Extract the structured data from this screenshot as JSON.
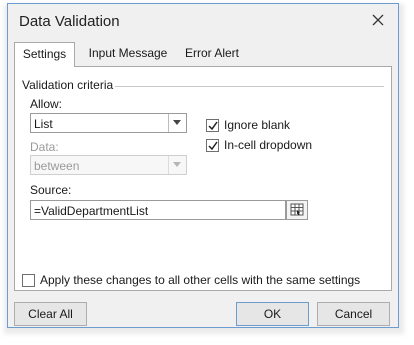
{
  "dialog": {
    "title": "Data Validation"
  },
  "tabs": [
    {
      "label": "Settings"
    },
    {
      "label": "Input Message"
    },
    {
      "label": "Error Alert"
    }
  ],
  "settings": {
    "group_label": "Validation criteria",
    "allow_label": "Allow:",
    "allow_value": "List",
    "data_label": "Data:",
    "data_value": "between",
    "ignore_blank_label": "Ignore blank",
    "ignore_blank_checked": true,
    "incell_dropdown_label": "In-cell dropdown",
    "incell_dropdown_checked": true,
    "source_label": "Source:",
    "source_value": "=ValidDepartmentList",
    "apply_all_label": "Apply these changes to all other cells with the same settings",
    "apply_all_checked": false
  },
  "footer": {
    "clear_all_label": "Clear All",
    "ok_label": "OK",
    "cancel_label": "Cancel"
  },
  "colors": {
    "accent_border": "#6d9ccf",
    "dialog_bg": "#f0f0f0",
    "panel_bg": "#ffffff"
  }
}
